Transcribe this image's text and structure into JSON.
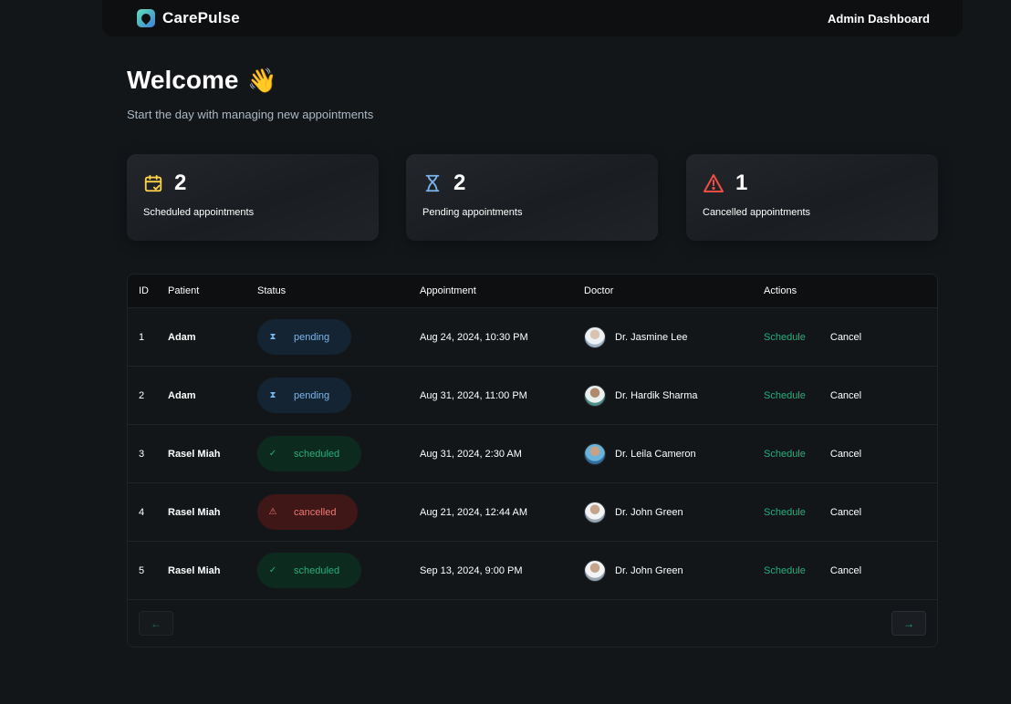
{
  "header": {
    "brand": "CarePulse",
    "admin_label": "Admin Dashboard"
  },
  "welcome": {
    "title": "Welcome",
    "emoji": "👋",
    "subtitle": "Start the day with managing new appointments"
  },
  "stats": [
    {
      "count": "2",
      "label": "Scheduled appointments",
      "icon": "calendar-check-icon",
      "color": "#ffd147"
    },
    {
      "count": "2",
      "label": "Pending appointments",
      "icon": "hourglass-icon",
      "color": "#79b5ec"
    },
    {
      "count": "1",
      "label": "Cancelled appointments",
      "icon": "warning-icon",
      "color": "#f24e43"
    }
  ],
  "table": {
    "columns": [
      "ID",
      "Patient",
      "Status",
      "Appointment",
      "Doctor",
      "Actions"
    ],
    "rows": [
      {
        "id": "1",
        "patient": "Adam",
        "status": "pending",
        "status_icon": "⧗",
        "appointment": "Aug 24, 2024, 10:30 PM",
        "doctor": "Dr. Jasmine Lee",
        "schedule": "Schedule",
        "cancel": "Cancel"
      },
      {
        "id": "2",
        "patient": "Adam",
        "status": "pending",
        "status_icon": "⧗",
        "appointment": "Aug 31, 2024, 11:00 PM",
        "doctor": "Dr. Hardik Sharma",
        "schedule": "Schedule",
        "cancel": "Cancel"
      },
      {
        "id": "3",
        "patient": "Rasel Miah",
        "status": "scheduled",
        "status_icon": "✓",
        "appointment": "Aug 31, 2024, 2:30 AM",
        "doctor": "Dr. Leila Cameron",
        "schedule": "Schedule",
        "cancel": "Cancel"
      },
      {
        "id": "4",
        "patient": "Rasel Miah",
        "status": "cancelled",
        "status_icon": "⚠",
        "appointment": "Aug 21, 2024, 12:44 AM",
        "doctor": "Dr. John Green",
        "schedule": "Schedule",
        "cancel": "Cancel"
      },
      {
        "id": "5",
        "patient": "Rasel Miah",
        "status": "scheduled",
        "status_icon": "✓",
        "appointment": "Sep 13, 2024, 9:00 PM",
        "doctor": "Dr. John Green",
        "schedule": "Schedule",
        "cancel": "Cancel"
      }
    ]
  },
  "pagination": {
    "prev_icon": "←",
    "next_icon": "→"
  },
  "colors": {
    "background": "#131619",
    "accent_green": "#24ae7c",
    "pending_blue": "#79b5ec",
    "cancel_red": "#f37877",
    "schedule_yellow": "#ffd147"
  }
}
